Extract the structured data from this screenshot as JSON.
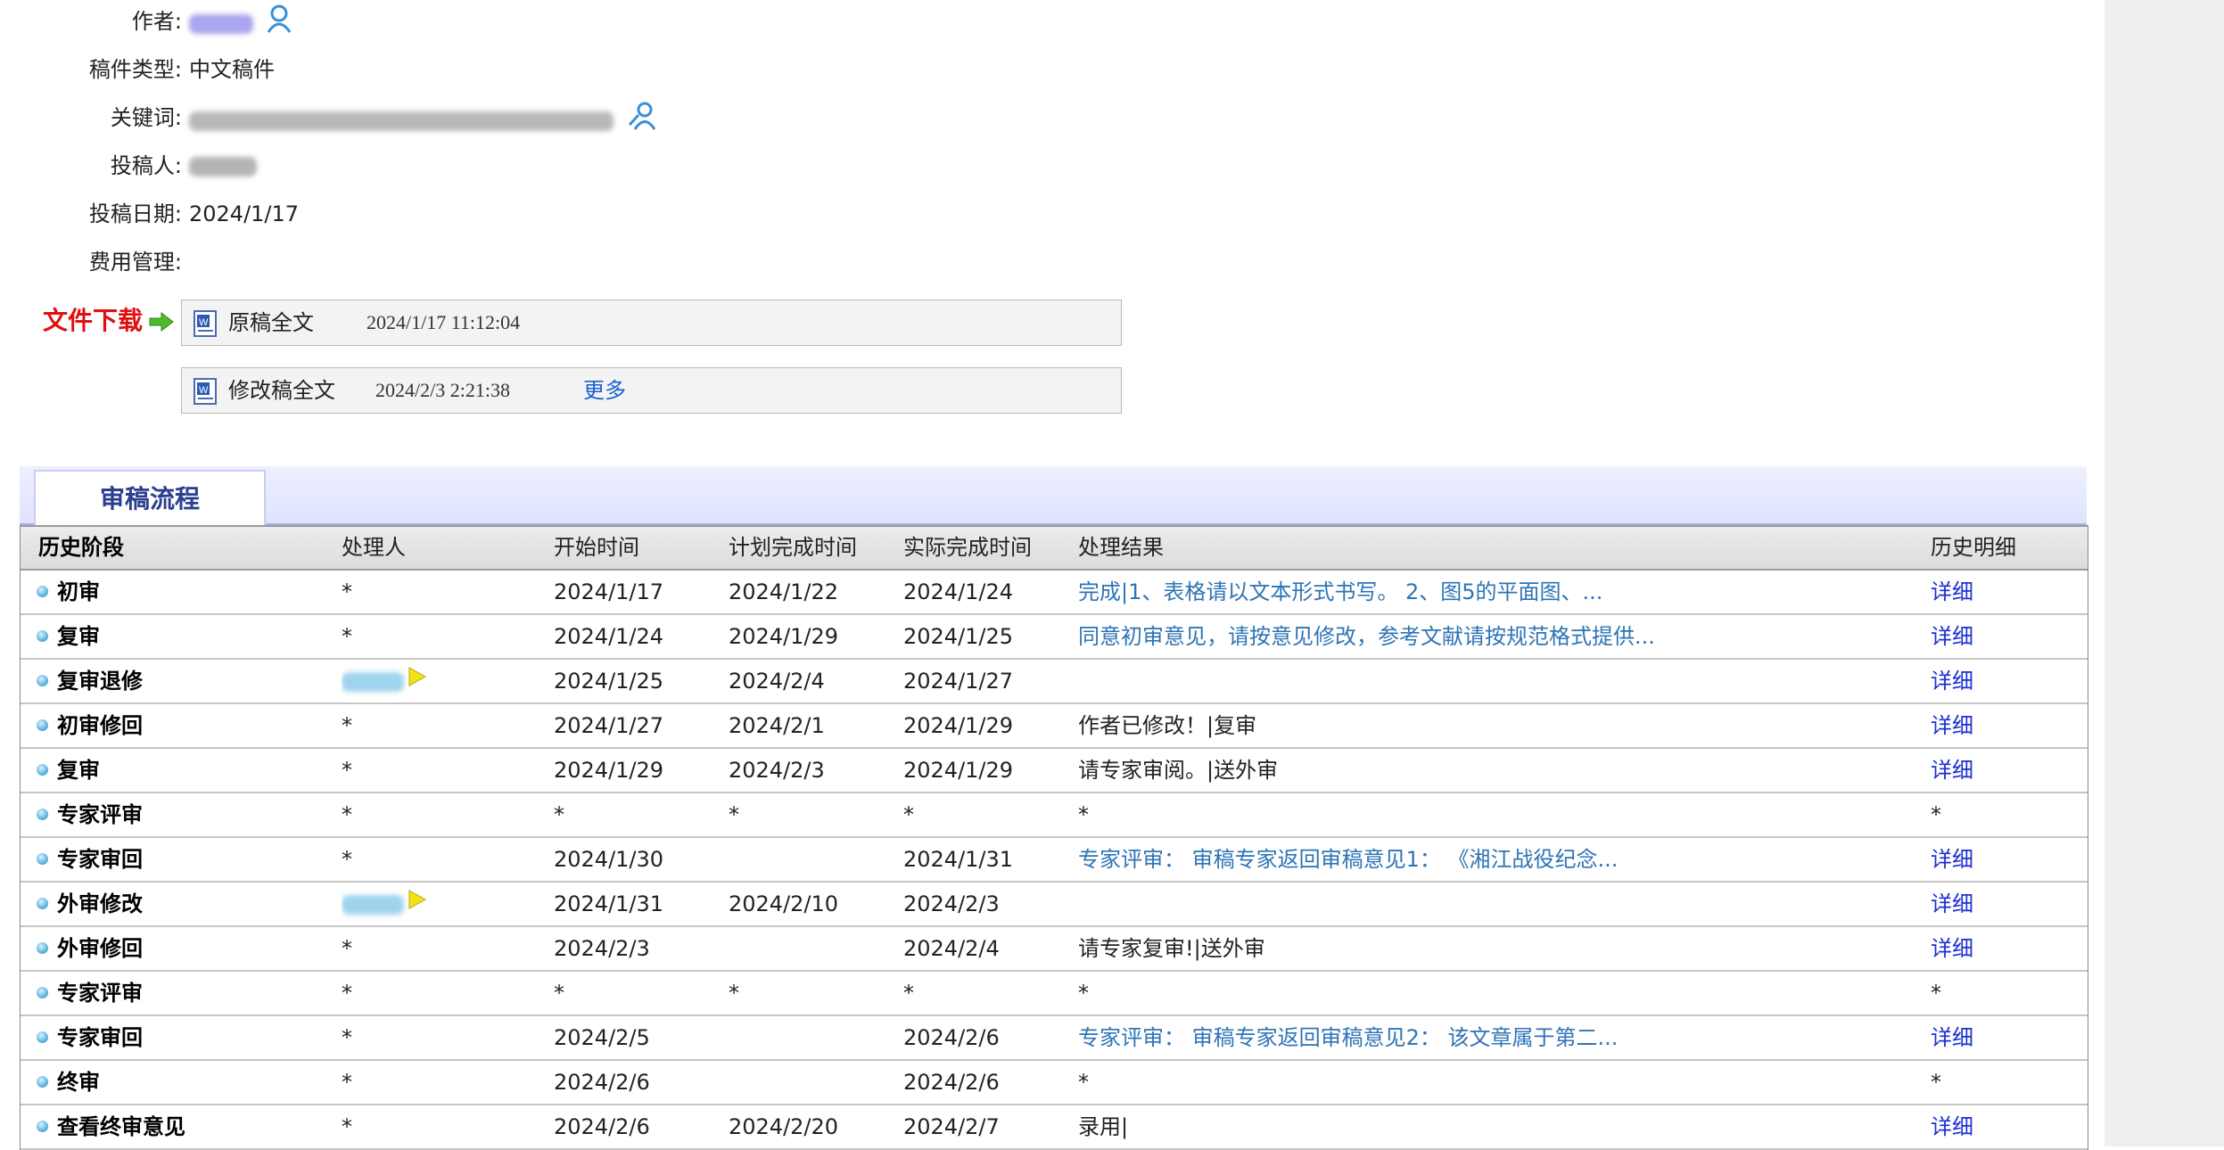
{
  "info": {
    "author_label": "作者:",
    "type_label": "稿件类型:",
    "type_value": "中文稿件",
    "keywords_label": "关键词:",
    "submitter_label": "投稿人:",
    "date_label": "投稿日期:",
    "date_value": "2024/1/17",
    "fee_label": "费用管理:"
  },
  "downloads": {
    "label": "文件下载",
    "files": [
      {
        "name": "原稿全文",
        "time": "2024/1/17 11:12:04"
      },
      {
        "name": "修改稿全文",
        "time": "2024/2/3 2:21:38",
        "more": "更多"
      }
    ]
  },
  "flow": {
    "tab_label": "审稿流程",
    "headers": {
      "stage": "历史阶段",
      "handler": "处理人",
      "start": "开始时间",
      "plan": "计划完成时间",
      "actual": "实际完成时间",
      "result": "处理结果",
      "detail": "历史明细"
    },
    "rows": [
      {
        "stage": "初审",
        "handler": "*",
        "start": "2024/1/17",
        "plan": "2024/1/22",
        "actual": "2024/1/24",
        "result": "完成|1、表格请以文本形式书写。 2、图5的平面图、...",
        "detail": "详细"
      },
      {
        "stage": "复审",
        "handler": "*",
        "start": "2024/1/24",
        "plan": "2024/1/29",
        "actual": "2024/1/25",
        "result": "同意初审意见，请按意见修改，参考文献请按规范格式提供...",
        "detail": "详细"
      },
      {
        "stage": "复审退修",
        "handler": "",
        "start": "2024/1/25",
        "plan": "2024/2/4",
        "actual": "2024/1/27",
        "result": "",
        "detail": "详细"
      },
      {
        "stage": "初审修回",
        "handler": "*",
        "start": "2024/1/27",
        "plan": "2024/2/1",
        "actual": "2024/1/29",
        "result": "作者已修改！|复审",
        "detail": "详细"
      },
      {
        "stage": "复审",
        "handler": "*",
        "start": "2024/1/29",
        "plan": "2024/2/3",
        "actual": "2024/1/29",
        "result": "请专家审阅。|送外审",
        "detail": "详细"
      },
      {
        "stage": "专家评审",
        "handler": "*",
        "start": "*",
        "plan": "*",
        "actual": "*",
        "result": "*",
        "detail": "*"
      },
      {
        "stage": "专家审回",
        "handler": "*",
        "start": "2024/1/30",
        "plan": "",
        "actual": "2024/1/31",
        "result": "专家评审： 审稿专家返回审稿意见1： 《湘江战役纪念...",
        "detail": "详细"
      },
      {
        "stage": "外审修改",
        "handler": "",
        "start": "2024/1/31",
        "plan": "2024/2/10",
        "actual": "2024/2/3",
        "result": "",
        "detail": "详细"
      },
      {
        "stage": "外审修回",
        "handler": "*",
        "start": "2024/2/3",
        "plan": "",
        "actual": "2024/2/4",
        "result": "请专家复审!|送外审",
        "detail": "详细"
      },
      {
        "stage": "专家评审",
        "handler": "*",
        "start": "*",
        "plan": "*",
        "actual": "*",
        "result": "*",
        "detail": "*"
      },
      {
        "stage": "专家审回",
        "handler": "*",
        "start": "2024/2/5",
        "plan": "",
        "actual": "2024/2/6",
        "result": "专家评审： 审稿专家返回审稿意见2： 该文章属于第二...",
        "detail": "详细"
      },
      {
        "stage": "终审",
        "handler": "*",
        "start": "2024/2/6",
        "plan": "",
        "actual": "2024/2/6",
        "result": "*",
        "detail": "*"
      },
      {
        "stage": "查看终审意见",
        "handler": "*",
        "start": "2024/2/6",
        "plan": "2024/2/20",
        "actual": "2024/2/7",
        "result": "录用|",
        "detail": "详细"
      }
    ]
  },
  "colors": {
    "download_label": "#e01010",
    "link_result": "#2f74b5",
    "link_detail": "#1b2fd4",
    "tab_text": "#2a3f8f"
  },
  "icons": [
    "person-icon",
    "search-person-icon",
    "arrow-right-icon",
    "word-document-icon",
    "bullet-icon",
    "flag-icon"
  ]
}
